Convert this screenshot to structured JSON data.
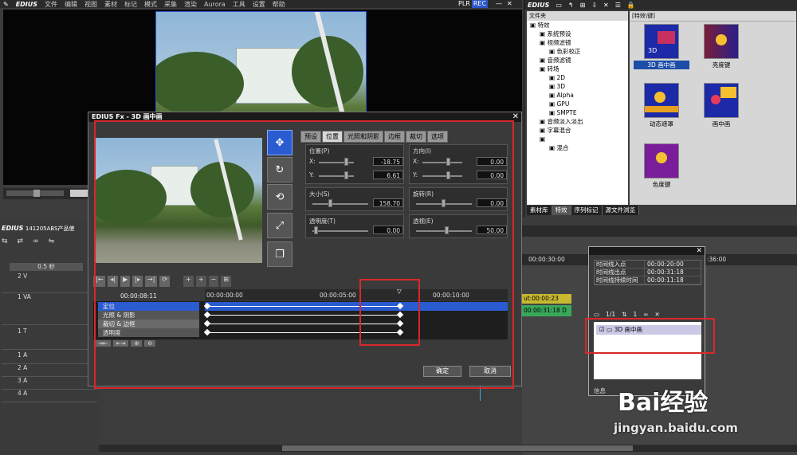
{
  "menubar": {
    "brand": "EDIUS",
    "items": [
      "文件",
      "编辑",
      "视图",
      "素材",
      "标记",
      "模式",
      "采集",
      "渲染",
      "Aurora",
      "工具",
      "设置",
      "帮助"
    ],
    "plr": "PLR",
    "rec": "REC"
  },
  "effects_panel": {
    "brand": "EDIUS",
    "tree_header": "文件夹",
    "tree": [
      {
        "label": "特效",
        "indent": 0
      },
      {
        "label": "系统预设",
        "indent": 1
      },
      {
        "label": "视频滤镜",
        "indent": 1
      },
      {
        "label": "色彩校正",
        "indent": 2
      },
      {
        "label": "音频滤镜",
        "indent": 1
      },
      {
        "label": "转场",
        "indent": 1
      },
      {
        "label": "2D",
        "indent": 2
      },
      {
        "label": "3D",
        "indent": 2
      },
      {
        "label": "Alpha",
        "indent": 2
      },
      {
        "label": "GPU",
        "indent": 2
      },
      {
        "label": "SMPTE",
        "indent": 2
      },
      {
        "label": "音频淡入淡出",
        "indent": 1
      },
      {
        "label": "字幕混合",
        "indent": 1
      },
      {
        "label": "",
        "indent": 1
      },
      {
        "label": "混合",
        "indent": 2
      }
    ],
    "thumbs_header": "[特效\\键]",
    "thumbs": [
      {
        "label": "3D 画中画",
        "selected": true,
        "inner": "3D"
      },
      {
        "label": "亮度键",
        "selected": false,
        "inner": ""
      },
      {
        "label": "动态遮罩",
        "selected": false,
        "inner": ""
      },
      {
        "label": "画中画",
        "selected": false,
        "inner": ""
      },
      {
        "label": "色度键",
        "selected": false,
        "inner": ""
      }
    ],
    "tabs": [
      "素材库",
      "特效",
      "序列标记",
      "源文件浏览"
    ]
  },
  "timeline_left": {
    "brand": "EDIUS",
    "project": "141205ABS产品使",
    "zoom": "0.5 秒",
    "tracks": [
      "2 V",
      "1 VA",
      "1 T",
      "1 A",
      "2 A",
      "3 A",
      "4 A"
    ]
  },
  "dialog": {
    "title": "EDIUS Fx - 3D 画中画",
    "tabs": [
      "预设",
      "位置",
      "光照和阴影",
      "边框",
      "裁切",
      "选项"
    ],
    "position": {
      "label": "位置(P)",
      "x_label": "X:",
      "x_value": "-18.75",
      "y_label": "Y:",
      "y_value": "6.61"
    },
    "direction": {
      "label": "方向(I)",
      "x_label": "X:",
      "x_value": "0.00",
      "y_label": "Y:",
      "y_value": "0.00"
    },
    "size": {
      "label": "大小(S)",
      "value": "158.70"
    },
    "rotation": {
      "label": "旋转(R)",
      "value": "0.00"
    },
    "opacity": {
      "label": "透明度(T)",
      "value": "0.00"
    },
    "perspective": {
      "label": "透视(E)",
      "value": "50.00"
    },
    "current_time": "00:00:08:11",
    "ruler": [
      "00:00:00:00",
      "00:00:05:00",
      "00:00:10:00"
    ],
    "keyframe_rows": [
      "定位",
      "光照 & 阴影",
      "裁切 & 边框",
      "透明度"
    ],
    "ok": "确定",
    "cancel": "取消"
  },
  "info_panel": {
    "rows": [
      {
        "k": "时间线入点",
        "v": "00:00:20:00"
      },
      {
        "k": "时间线出点",
        "v": "00:00:31:18"
      },
      {
        "k": "时间线持续时间",
        "v": "00:00:11:18"
      }
    ],
    "page": "1/1",
    "layer": "1",
    "effect_item": "3D 画中画",
    "footer": "信息"
  },
  "timeline_right": {
    "ruler": [
      "00:00:30:00",
      ":36:00"
    ],
    "clip_a": "ut:00:00:23",
    "clip_b": "00:00:31:18 D"
  },
  "watermark": {
    "main": "Bai经验",
    "url": "jingyan.baidu.com"
  }
}
